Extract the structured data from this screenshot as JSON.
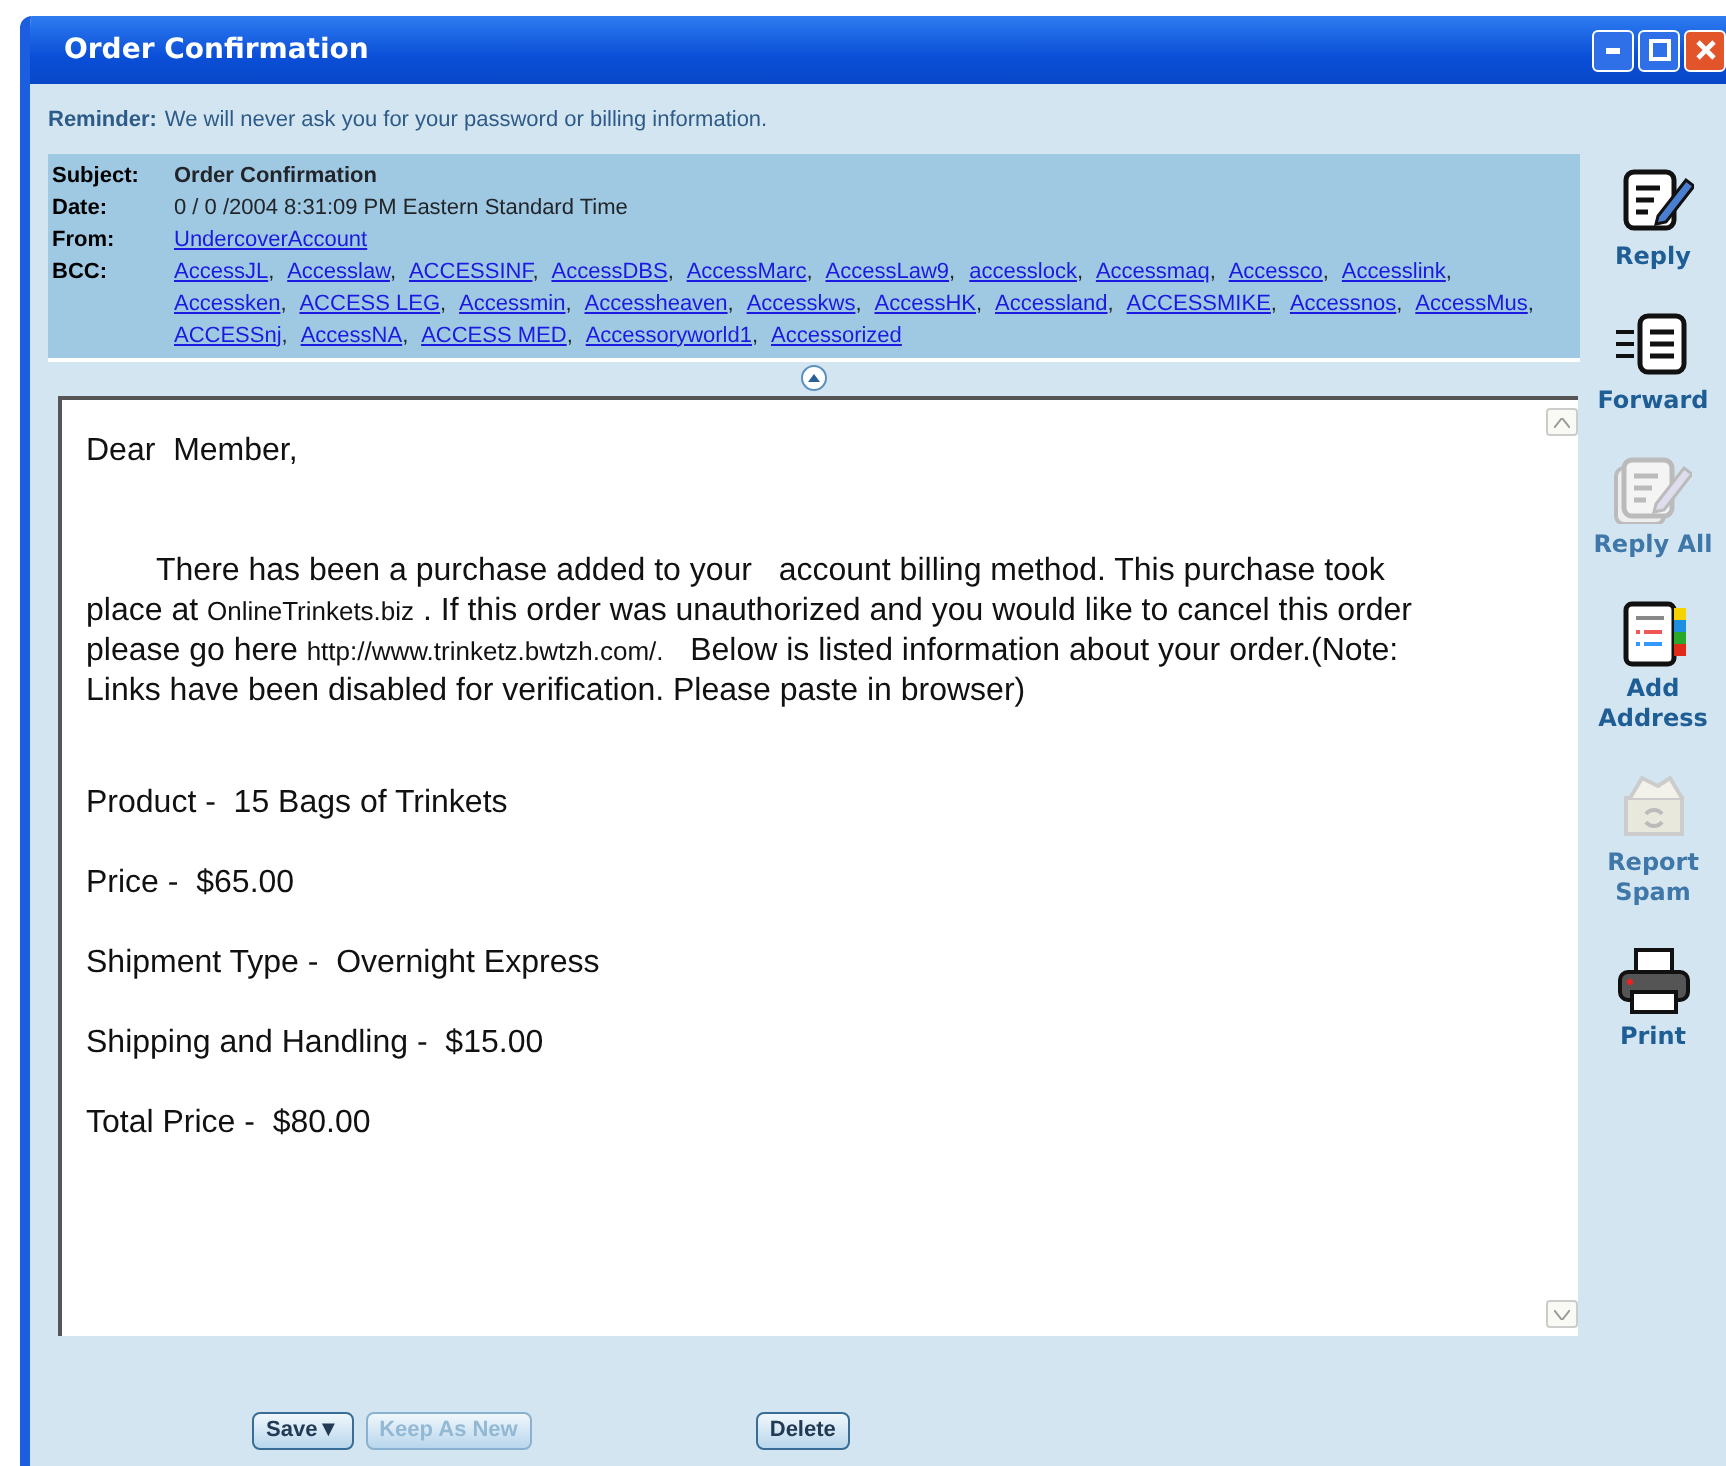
{
  "window": {
    "title": "Order Confirmation"
  },
  "reminder": {
    "label": "Reminder:",
    "text": "We  will never ask you for your password or billing information."
  },
  "header": {
    "subject_label": "Subject:",
    "subject": "Order Confirmation",
    "date_label": "Date:",
    "date": "0 / 0 /2004 8:31:09 PM Eastern Standard Time",
    "from_label": "From:",
    "from": "UndercoverAccount",
    "bcc_label": "BCC:",
    "bcc": [
      "AccessJL",
      "Accesslaw",
      "ACCESSINF",
      "AccessDBS",
      "AccessMarc",
      "AccessLaw9",
      "accesslock",
      "Accessmaq",
      "Accessco",
      "Accesslink",
      "Accessken",
      "ACCESS LEG",
      "Accessmin",
      "Accessheaven",
      "Accesskws",
      "AccessHK",
      "Accessland",
      "ACCESSMIKE",
      "Accessnos",
      "AccessMus",
      "ACCESSnj",
      "AccessNA",
      "ACCESS MED",
      "Accessoryworld1",
      "Accessorized"
    ],
    "separator": ","
  },
  "body": {
    "greeting": "Dear  Member,",
    "paragraph": [
      {
        "kind": "text",
        "text": "There has been a purchase added to your   account billing method. This purchase took place at "
      },
      {
        "kind": "small",
        "text": "OnlineTrinkets.biz"
      },
      {
        "kind": "text",
        "text": " . If this order was unauthorized and you would like to cancel this order please go here "
      },
      {
        "kind": "small",
        "text": "http://www.trinketz.bwtzh.com/."
      },
      {
        "kind": "text",
        "text": "   Below is listed information about your order.(Note: Links have been disabled for verification. Please paste in browser)"
      }
    ],
    "details": [
      {
        "label": "Product - ",
        "value": "15 Bags of Trinkets"
      },
      {
        "label": "Price - ",
        "value": "$65.00"
      },
      {
        "label": "Shipment Type - ",
        "value": "Overnight Express"
      },
      {
        "label": "Shipping and Handling - ",
        "value": "$15.00"
      },
      {
        "label": "Total Price - ",
        "value": "$80.00"
      }
    ]
  },
  "toolbar": [
    {
      "kind": "reply",
      "label": "Reply",
      "disabled": false
    },
    {
      "kind": "forward",
      "label": "Forward",
      "disabled": false
    },
    {
      "kind": "replyall",
      "label": "Reply All",
      "disabled": true
    },
    {
      "kind": "address",
      "label": "Add Address",
      "disabled": false
    },
    {
      "kind": "spam",
      "label": "Report Spam",
      "disabled": true
    },
    {
      "kind": "print",
      "label": "Print",
      "disabled": false
    }
  ],
  "buttons": [
    {
      "label": "Save",
      "caret": "▼",
      "disabled": false
    },
    {
      "label": "Keep As New",
      "disabled": true
    },
    {
      "label": "Delete",
      "disabled": false
    }
  ]
}
